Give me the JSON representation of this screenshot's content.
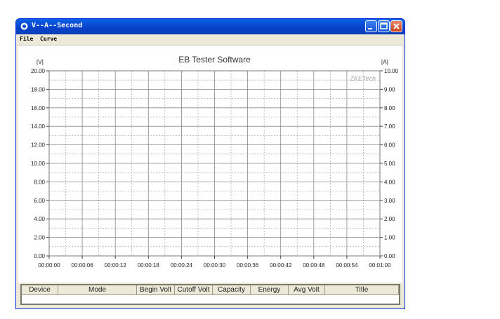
{
  "window": {
    "title": "V--A--Second"
  },
  "menu": {
    "items": [
      "File",
      "Curve"
    ]
  },
  "chart_data": {
    "type": "line",
    "title": "EB Tester Software",
    "watermark": "ZKETech",
    "ylabel_left": "[V]",
    "ylabel_right": "[A]",
    "y_left_ticks": [
      "20.00",
      "18.00",
      "16.00",
      "14.00",
      "12.00",
      "10.00",
      "8.00",
      "6.00",
      "4.00",
      "2.00",
      "0.00"
    ],
    "y_right_ticks": [
      "10.00",
      "9.00",
      "8.00",
      "7.00",
      "6.00",
      "5.00",
      "4.00",
      "3.00",
      "2.00",
      "1.00",
      "0.00"
    ],
    "x_ticks": [
      "00:00:00",
      "00:00:06",
      "00:00:12",
      "00:00:18",
      "00:00:24",
      "00:00:30",
      "00:00:36",
      "00:00:42",
      "00:00:48",
      "00:00:54",
      "00:01:00"
    ],
    "ylim_left": [
      0,
      20
    ],
    "ylim_right": [
      0,
      10
    ],
    "grid": true,
    "series": []
  },
  "table": {
    "columns": [
      "Device",
      "Mode",
      "Begin Volt",
      "Cutoff Volt",
      "Capacity",
      "Energy",
      "Avg Volt",
      "Title"
    ]
  },
  "colors": {
    "titlebar": "#0A4FD8",
    "window_bg": "#ECE9D8",
    "grid": "#888888"
  }
}
